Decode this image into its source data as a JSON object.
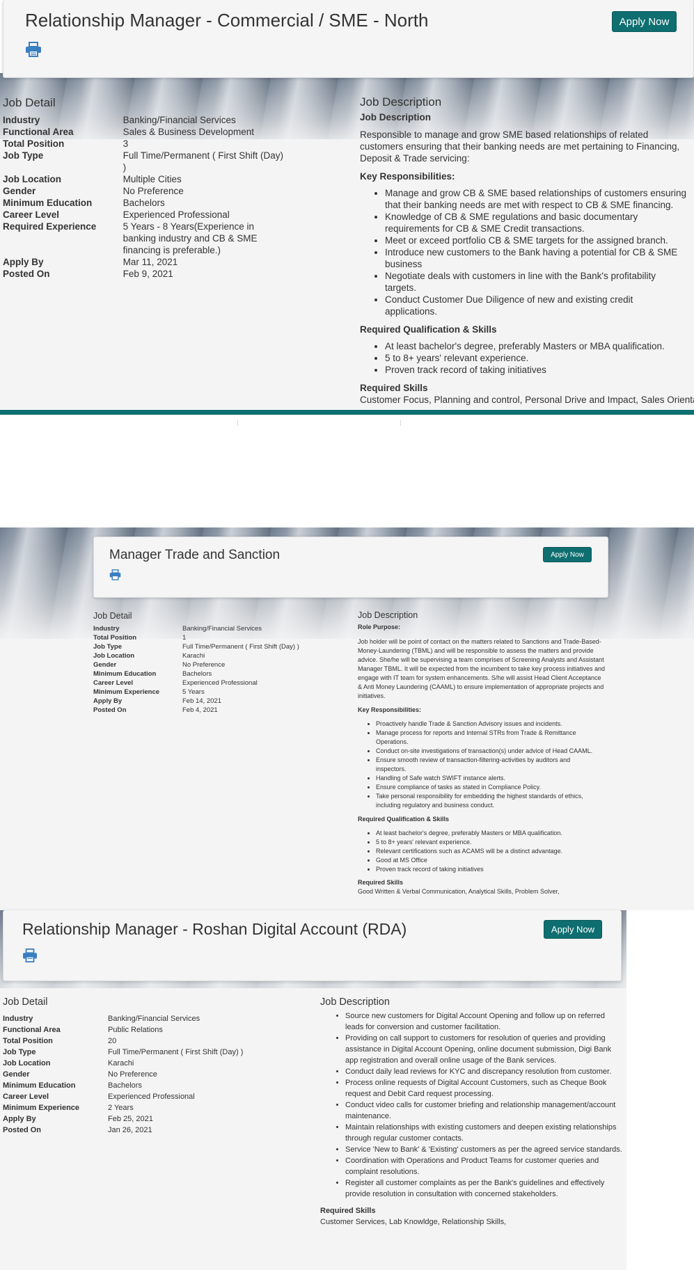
{
  "job1": {
    "title": "Relationship Manager - Commercial / SME - North",
    "apply_label": "Apply Now",
    "detail_heading": "Job Detail",
    "details": [
      {
        "label": "Industry",
        "value": "Banking/Financial Services"
      },
      {
        "label": "Functional Area",
        "value": "Sales & Business Development"
      },
      {
        "label": "Total Position",
        "value": "3"
      },
      {
        "label": "Job Type",
        "value": "Full Time/Permanent ( First Shift (Day) )"
      },
      {
        "label": "Job Location",
        "value": "Multiple Cities"
      },
      {
        "label": "Gender",
        "value": "No Preference"
      },
      {
        "label": "Minimum Education",
        "value": "Bachelors"
      },
      {
        "label": "Career Level",
        "value": "Experienced Professional"
      },
      {
        "label": "Required Experience",
        "value": "5 Years - 8 Years(Experience in banking industry and CB & SME financing is preferable.)"
      },
      {
        "label": "Apply By",
        "value": "Mar 11, 2021"
      },
      {
        "label": "Posted On",
        "value": "Feb 9, 2021"
      }
    ],
    "desc_heading": "Job Description",
    "desc_sub": "Job Description",
    "intro": "Responsible to manage and grow SME based relationships of related customers ensuring that their banking needs are met pertaining to Financing, Deposit & Trade servicing:",
    "resp_heading": "Key Responsibilities:",
    "responsibilities": [
      "Manage and grow CB & SME based relationships of customers ensuring that their banking needs are met with respect to CB & SME financing.",
      "Knowledge of CB & SME regulations and basic documentary requirements for CB & SME Credit transactions.",
      "Meet or exceed portfolio CB & SME targets for the assigned branch.",
      "Introduce new customers to the Bank having a potential for CB & SME business",
      "Negotiate deals with customers in line with the Bank's profitability targets.",
      "Conduct Customer Due Diligence of new and existing credit applications."
    ],
    "qual_heading": "Required Qualification & Skills",
    "qualifications": [
      "At least bachelor's degree, preferably Masters or MBA qualification.",
      "5 to 8+ years' relevant experience.",
      "Proven track record of taking initiatives"
    ],
    "skills_heading": "Required Skills",
    "skills": "Customer Focus, Planning and control, Personal Drive and Impact, Sales Orientation,"
  },
  "job2": {
    "title": "Manager Trade and Sanction",
    "apply_label": "Apply Now",
    "detail_heading": "Job Detail",
    "details": [
      {
        "label": "Industry",
        "value": "Banking/Financial Services"
      },
      {
        "label": "Total Position",
        "value": "1"
      },
      {
        "label": "Job Type",
        "value": "Full Time/Permanent ( First Shift (Day) )"
      },
      {
        "label": "Job Location",
        "value": "Karachi"
      },
      {
        "label": "Gender",
        "value": "No Preference"
      },
      {
        "label": "Minimum Education",
        "value": "Bachelors"
      },
      {
        "label": "Career Level",
        "value": "Experienced Professional"
      },
      {
        "label": "Minimum Experience",
        "value": "5 Years"
      },
      {
        "label": "Apply By",
        "value": "Feb 14, 2021"
      },
      {
        "label": "Posted On",
        "value": "Feb 4, 2021"
      }
    ],
    "desc_heading": "Job Description",
    "role_heading": "Role Purpose:",
    "role_text": "Job holder will be point of contact on the matters related to Sanctions and Trade-Based-Money-Laundering (TBML) and will be responsible to assess the matters and provide advice. She/he will be supervising a team comprises of Screening Analysts and Assistant Manager TBML. It will be expected from the incumbent to take key process initiatives and engage with IT team for system enhancements. S/he will assist Head Client Acceptance & Anti Money Laundering (CAAML) to ensure implementation of appropriate projects and initiatives.",
    "resp_heading": "Key Responsibilities:",
    "responsibilities": [
      "Proactively handle Trade & Sanction Advisory issues and incidents.",
      "Manage process for reports and Internal STRs from Trade & Remittance Operations.",
      "Conduct on-site investigations of transaction(s) under advice of Head CAAML.",
      "Ensure smooth review of transaction-filtering-activities by auditors and inspectors.",
      "Handling of Safe watch SWIFT instance alerts.",
      "Ensure compliance of tasks as stated in Compliance Policy.",
      "Take personal responsibility for embedding the highest standards of ethics, including regulatory and business conduct."
    ],
    "qual_heading": "Required Qualification & Skills",
    "qualifications": [
      "At least bachelor's degree, preferably Masters or MBA qualification.",
      "5 to 8+ years' relevant experience.",
      "Relevant certifications such as ACAMS will be a distinct advantage.",
      "Good at MS Office",
      "Proven track record of taking initiatives"
    ],
    "skills_heading": "Required Skills",
    "skills": "Good Written & Verbal Communication, Analytical Skills, Problem Solver,"
  },
  "job3": {
    "title": "Relationship Manager - Roshan Digital Account (RDA)",
    "apply_label": "Apply Now",
    "detail_heading": "Job Detail",
    "details": [
      {
        "label": "Industry",
        "value": "Banking/Financial Services"
      },
      {
        "label": "Functional Area",
        "value": "Public Relations"
      },
      {
        "label": "Total Position",
        "value": "20"
      },
      {
        "label": "Job Type",
        "value": "Full Time/Permanent ( First Shift (Day) )"
      },
      {
        "label": "Job Location",
        "value": "Karachi"
      },
      {
        "label": "Gender",
        "value": "No Preference"
      },
      {
        "label": "Minimum Education",
        "value": "Bachelors"
      },
      {
        "label": "Career Level",
        "value": "Experienced Professional"
      },
      {
        "label": "Minimum Experience",
        "value": "2 Years"
      },
      {
        "label": "Apply By",
        "value": "Feb 25, 2021"
      },
      {
        "label": "Posted On",
        "value": "Jan 26, 2021"
      }
    ],
    "desc_heading": "Job Description",
    "responsibilities": [
      "Source new customers for Digital Account Opening and follow up on referred leads for conversion and customer facilitation.",
      "Providing on call support to customers for resolution of queries and providing assistance in Digital Account Opening, online document submission, Digi Bank app registration and overall online usage of the Bank services.",
      "Conduct daily lead reviews for KYC and discrepancy resolution from customer.",
      "Process online requests of Digital Account Customers, such as Cheque Book request and Debit Card request processing.",
      "Conduct video calls for customer briefing and relationship management/account maintenance.",
      "Maintain relationships with existing customers and deepen existing relationships through regular customer contacts.",
      "Service 'New to Bank' & 'Existing' customers as per the agreed service standards.",
      "Coordination with Operations and Product Teams for customer queries and complaint resolutions.",
      "Register all customer complaints as per the Bank's guidelines and effectively provide resolution in consultation with concerned stakeholders."
    ],
    "skills_heading": "Required Skills",
    "skills": "Customer Services, Lab Knowldge, Relationship Skills,"
  },
  "colors": {
    "accent": "#0e6e70",
    "print_icon": "#3a7fc1"
  }
}
